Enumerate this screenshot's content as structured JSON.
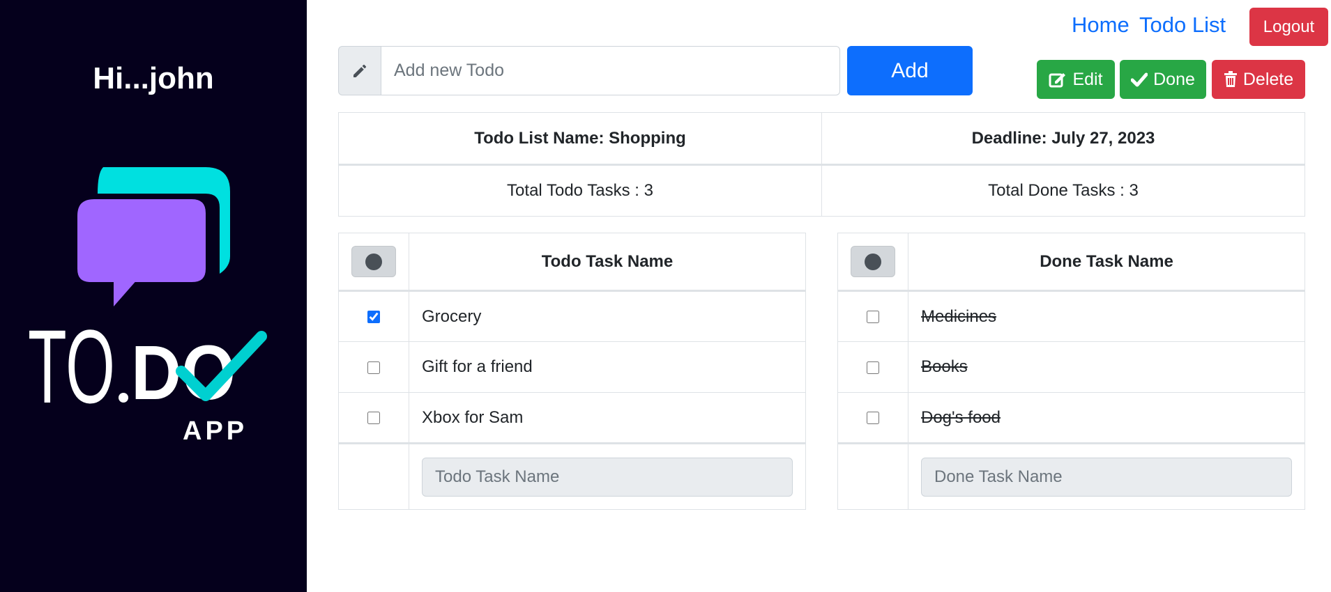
{
  "sidebar": {
    "greeting": "Hi...john",
    "logo": {
      "text": "TO.DO",
      "sub": "APP"
    }
  },
  "nav": {
    "home": "Home",
    "todo_list": "Todo List",
    "logout": "Logout"
  },
  "add_form": {
    "placeholder": "Add new Todo",
    "button": "Add"
  },
  "actions": {
    "edit": "Edit",
    "done": "Done",
    "delete": "Delete"
  },
  "info": {
    "list_name": "Todo List Name: Shopping",
    "deadline": "Deadline: July 27, 2023",
    "total_todo": "Total Todo Tasks : 3",
    "total_done": "Total Done Tasks : 3"
  },
  "todo_table": {
    "header": "Todo Task Name",
    "rows": [
      {
        "name": "Grocery",
        "checked": true
      },
      {
        "name": "Gift for a friend",
        "checked": false
      },
      {
        "name": "Xbox for Sam",
        "checked": false
      }
    ],
    "input_placeholder": "Todo Task Name"
  },
  "done_table": {
    "header": "Done Task Name",
    "rows": [
      {
        "name": "Medicines",
        "checked": false
      },
      {
        "name": "Books",
        "checked": false
      },
      {
        "name": "Dog's food",
        "checked": false
      }
    ],
    "input_placeholder": "Done Task Name"
  },
  "colors": {
    "sidebar_bg": "#05001c",
    "primary": "#0d6efd",
    "success": "#28a745",
    "danger": "#dc3545",
    "logo_purple": "#a066ff",
    "logo_cyan": "#00e0e0"
  }
}
